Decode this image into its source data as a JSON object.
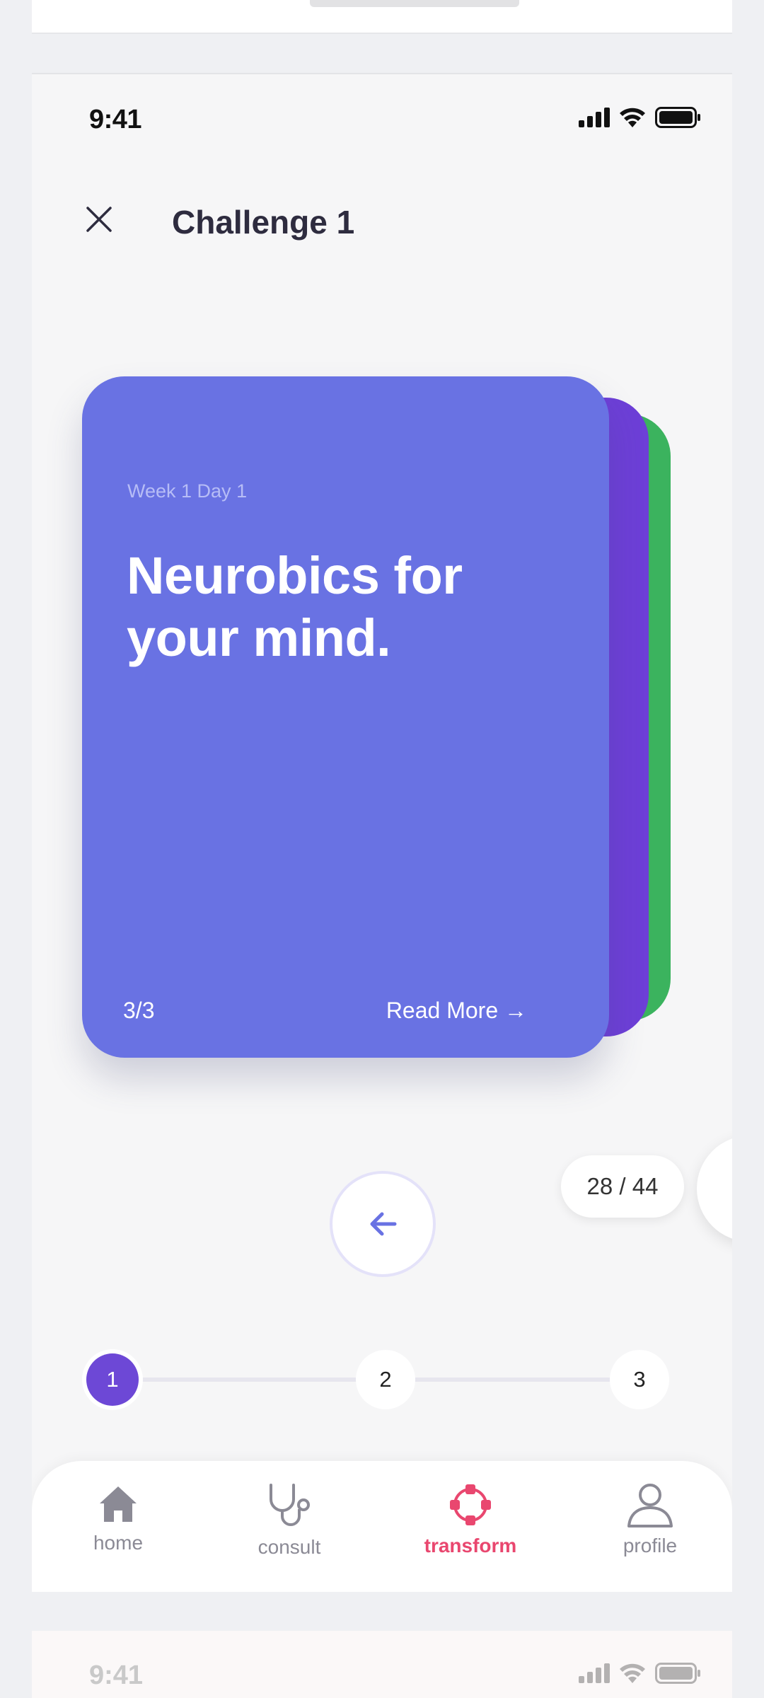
{
  "status": {
    "time": "9:41"
  },
  "header": {
    "title": "Challenge 1"
  },
  "card": {
    "week": "Week 1 Day 1",
    "title": "Neurobics for your mind.",
    "count": "3/3",
    "read_more": "Read More →"
  },
  "pager": {
    "counter": "28 / 44"
  },
  "stepper": {
    "steps": [
      "1",
      "2",
      "3"
    ],
    "active_step": 1
  },
  "nav": {
    "items": [
      {
        "label": "home",
        "icon": "home-icon"
      },
      {
        "label": "consult",
        "icon": "stethoscope-icon"
      },
      {
        "label": "transform",
        "icon": "transform-icon",
        "active": true
      },
      {
        "label": "profile",
        "icon": "profile-icon"
      }
    ]
  },
  "next_screen": {
    "time": "9:41"
  },
  "colors": {
    "card": "#6972e3",
    "card_back_purple": "#6d3fd7",
    "card_back_green": "#3bb35e",
    "accent": "#6d48d6",
    "nav_active": "#e9476f"
  }
}
